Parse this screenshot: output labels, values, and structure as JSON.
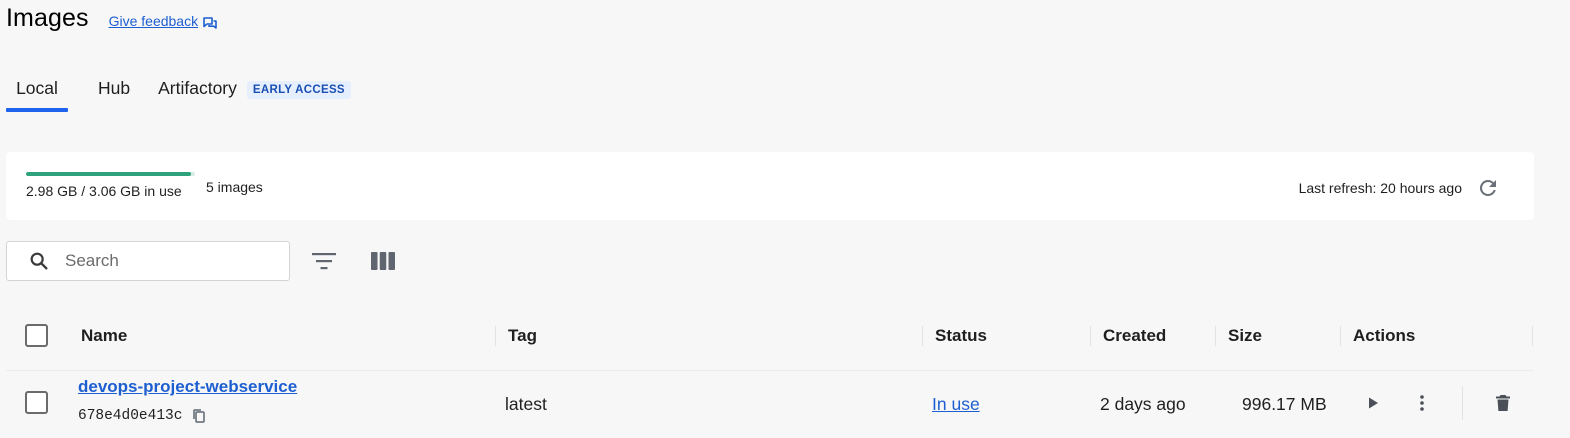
{
  "header": {
    "title": "Images",
    "feedback_label": "Give feedback"
  },
  "tabs": [
    {
      "label": "Local",
      "active": true
    },
    {
      "label": "Hub",
      "active": false
    },
    {
      "label": "Artifactory",
      "active": false,
      "badge": "EARLY ACCESS"
    }
  ],
  "disk": {
    "usage_label": "2.98 GB / 3.06 GB in use",
    "used_fraction": 0.974,
    "images_count": "5 images",
    "last_refresh": "Last refresh: 20 hours ago",
    "bar_color": "#2ea27d"
  },
  "toolbar": {
    "search_placeholder": "Search",
    "filter_icon": "filter-icon",
    "columns_icon": "columns-icon"
  },
  "table": {
    "columns": [
      "Name",
      "Tag",
      "Status",
      "Created",
      "Size",
      "Actions"
    ],
    "rows": [
      {
        "name": "devops-project-webservice",
        "id": "678e4d0e413c",
        "tag": "latest",
        "status": "In use",
        "created": "2 days ago",
        "size": "996.17 MB"
      }
    ]
  },
  "colors": {
    "accent": "#1d63ed",
    "link": "#1d5fd1",
    "badge_bg": "#e5effd"
  }
}
